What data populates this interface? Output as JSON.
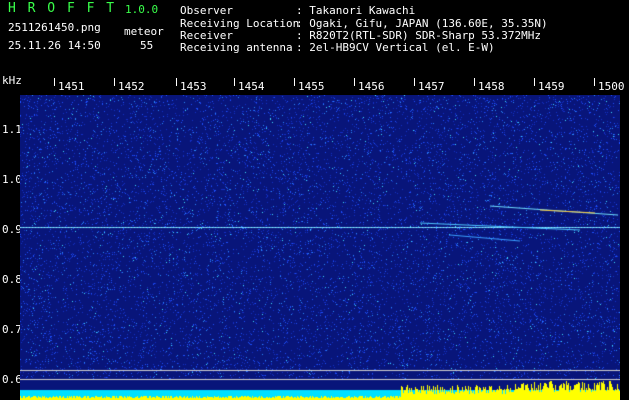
{
  "app": {
    "title": "H R O F F T",
    "version": "1.0.0"
  },
  "file": {
    "name": "2511261450.png",
    "datetime": "25.11.26 14:50"
  },
  "counter": {
    "label": "meteor",
    "value": "55"
  },
  "info": {
    "observer_label": "Observer",
    "observer_value": ": Takanori Kawachi",
    "location_label": "Receiving Location",
    "location_value": ": Ogaki, Gifu, JAPAN (136.60E, 35.35N)",
    "receiver_label": "Receiver",
    "receiver_value": ": R820T2(RTL-SDR) SDR-Sharp 53.372MHz",
    "antenna_label": "Receiving antenna",
    "antenna_value": ": 2el-HB9CV Vertical (el. E-W)"
  },
  "axis": {
    "unit": "kHz",
    "time_ticks": [
      "1451",
      "1452",
      "1453",
      "1454",
      "1455",
      "1456",
      "1457",
      "1458",
      "1459",
      "1500"
    ],
    "freq_ticks": [
      "1.1",
      "1.0",
      "0.9",
      "0.8",
      "0.7",
      "0.6"
    ]
  },
  "colors": {
    "background": "#000000",
    "header_green": "#39ff4a",
    "spectro_base": "#0a1a8a",
    "level_bar": "#ffff00"
  }
}
